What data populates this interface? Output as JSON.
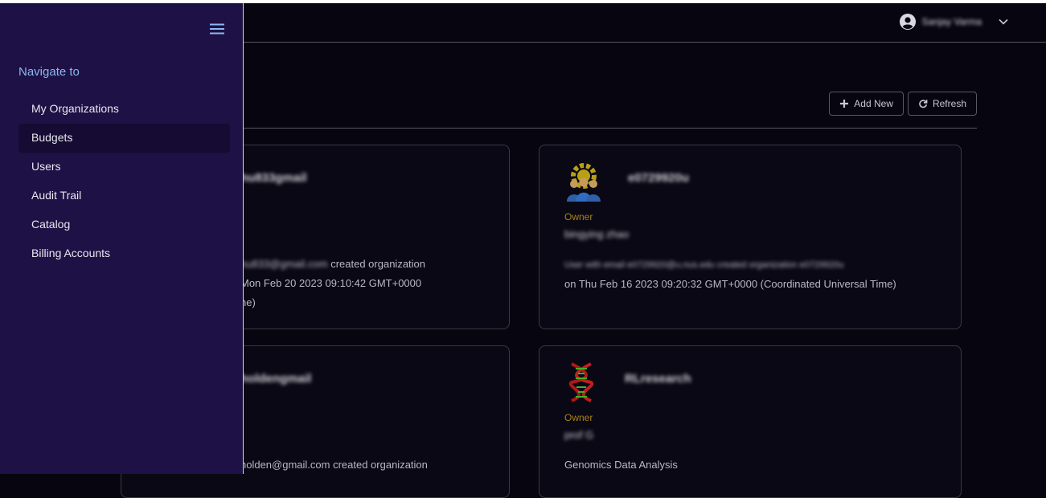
{
  "header": {
    "user_name": "Sanjay Varma"
  },
  "toolbar": {
    "add_label": "Add New",
    "refresh_label": "Refresh"
  },
  "sidebar": {
    "title": "Navigate to",
    "items": [
      {
        "label": "My Organizations"
      },
      {
        "label": "Budgets",
        "active": true
      },
      {
        "label": "Users"
      },
      {
        "label": "Audit Trail"
      },
      {
        "label": "Catalog"
      },
      {
        "label": "Billing Accounts"
      }
    ]
  },
  "cards": [
    {
      "name": "hu833gmail",
      "desc_blur": "hu833@gmail.com",
      "desc_1": " created organization",
      "desc_2": "Mon Feb 20 2023 09:10:42 GMT+0000",
      "desc_3": "ne)"
    },
    {
      "name": "e0729920u",
      "owner_label": "Owner",
      "owner_name": "bingying zhao",
      "desc_blur": "User with email e0729920@u.nus.edu created organization e0729920u",
      "desc_2": "on Thu Feb 16 2023 09:20:32 GMT+0000 (Coordinated Universal Time)"
    },
    {
      "name": "holdengmail",
      "desc_blur": "",
      "desc_1": "holden@gmail.com created organization"
    },
    {
      "name": "RLresearch",
      "owner_label": "Owner",
      "owner_name": "prof G",
      "desc_1": "Genomics Data Analysis"
    }
  ]
}
